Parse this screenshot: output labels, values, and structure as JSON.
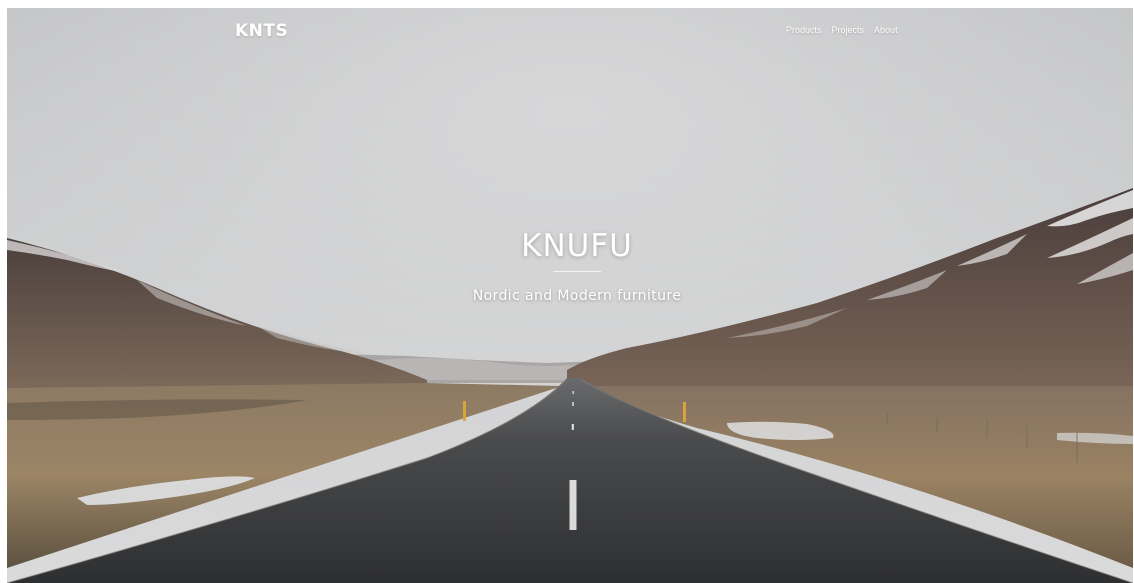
{
  "header": {
    "brand": "KNTS",
    "nav": [
      {
        "label": "Products"
      },
      {
        "label": "Projects"
      },
      {
        "label": "About"
      }
    ]
  },
  "hero": {
    "title": "KNUFU",
    "subtitle": "Nordic and Modern furniture",
    "background": "mountain-valley-road-photo"
  },
  "colors": {
    "text": "#ffffff",
    "sky": "#c9cacc",
    "road": "#3c3d3f",
    "mountains": "#5e4e48",
    "field": "#9b8466"
  }
}
